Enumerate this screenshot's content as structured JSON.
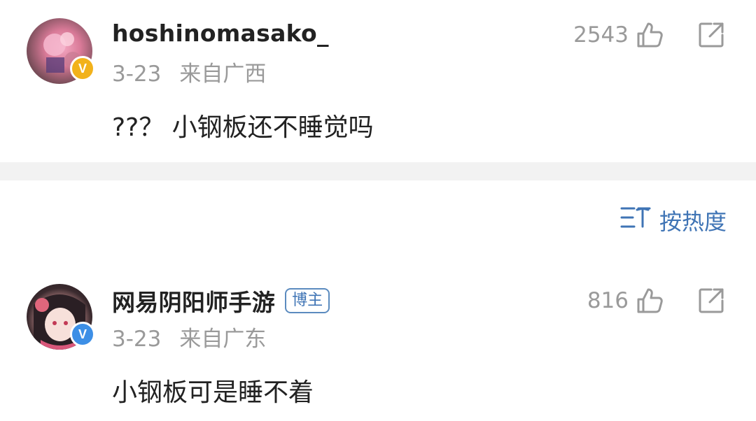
{
  "comments": [
    {
      "username": "hoshinomasako_",
      "date": "3-23",
      "location": "来自广西",
      "text": "??？ 小钢板还不睡觉吗",
      "likes": "2543",
      "verified_badge": "V",
      "verified_color": "#f2b21b"
    },
    {
      "username": "网易阴阳师手游",
      "tag": "博主",
      "date": "3-23",
      "location": "来自广东",
      "text": "小钢板可是睡不着",
      "likes": "816",
      "verified_badge": "V",
      "verified_color": "#3d8fe6"
    }
  ],
  "sort": {
    "label": "按热度",
    "icon": "sort-icon",
    "color": "#3f74b5"
  },
  "icons": {
    "like": "thumbs-up-icon",
    "share": "share-icon"
  }
}
